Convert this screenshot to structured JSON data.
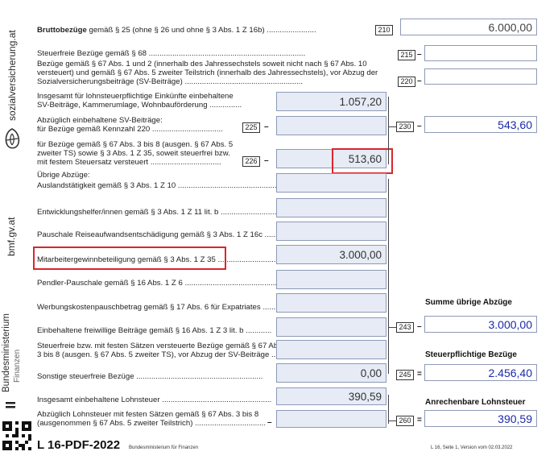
{
  "sidebar": {
    "website_1": "sozialversicherung.at",
    "website_2": "bmf.gv.at",
    "ministry_line1": "Bundesministerium",
    "ministry_line2": "Finanzen"
  },
  "rows": {
    "brutto_bold": "Bruttobezüge",
    "brutto_rest": " gemäß § 25 (ohne § 26 und ohne § 3 Abs. 1 Z 16b) .......................",
    "brutto_code": "210",
    "brutto_value": "6.000,00",
    "steuerfrei_68": "Steuerfreie Bezüge gemäß § 68 .........................................................................",
    "steuerfrei_68_code": "215",
    "bezuege_67_l1": "Bezüge gemäß § 67 Abs. 1 und 2 (innerhalb des Jahressechstels soweit nicht nach § 67 Abs. 10",
    "bezuege_67_l2": "versteuert) und gemäß § 67 Abs. 5 zweiter Teilstrich (innerhalb des Jahressechstels), vor Abzug der",
    "bezuege_67_l3": "Sozialversicherungsbeiträge (SV-Beiträge) .......................................................",
    "bezuege_67_code": "220",
    "insgesamt_l1": "Insgesamt für lohnsteuerpflichtige Einkünfte einbehaltene",
    "insgesamt_l2": "SV-Beiträge, Kammerumlage, Wohnbauförderung ...............",
    "insgesamt_value": "1.057,20",
    "abzueglich_l1": "Abzüglich einbehaltene SV-Beiträge:",
    "abzueglich_l2": "für Bezüge gemäß Kennzahl 220 .................................",
    "abzueglich_code": "225",
    "fuer_l1": "für Bezüge gemäß § 67 Abs. 3 bis 8 (ausgen. § 67 Abs. 5",
    "fuer_l2": "zweiter TS) sowie § 3 Abs. 1 Z 35, soweit steuerfrei bzw.",
    "fuer_l3": "mit festem Steuersatz versteuert .................................",
    "fuer_code": "226",
    "fuer_value": "513,60",
    "sum_230_code": "230",
    "sum_230_value": "543,60",
    "uebrige": "Übrige Abzüge:",
    "ausland": "Auslandstätigkeit gemäß § 3 Abs. 1 Z 10 ..................................................",
    "entwicklung": "Entwicklungshelfer/innen gemäß § 3 Abs. 1 Z 11 lit. b ...............................",
    "pauschale": "Pauschale Reiseaufwandsentschädigung gemäß § 3 Abs. 1 Z 16c ......",
    "mitarbeiter": "Mitarbeitergewinnbeteiligung gemäß § 3 Abs. 1 Z 35 ...............................",
    "mitarbeiter_value": "3.000,00",
    "pendler": "Pendler-Pauschale gemäß § 16 Abs. 1 Z 6 ..................................................",
    "werbung": "Werbungskostenpauschbetrag gemäß § 17 Abs. 6 für Expatriates ...........",
    "freiwillig": "Einbehaltene freiwillige Beiträge gemäß § 16 Abs. 1 Z 3 lit. b ............",
    "steuerfrei_fest_l1": "Steuerfreie bzw. mit festen Sätzen versteuerte Bezüge gemäß § 67 Abs.",
    "steuerfrei_fest_l2": "3 bis 8 (ausgen. § 67 Abs. 5 zweiter TS), vor Abzug der SV-Beiträge ........",
    "sonstige": "Sonstige steuerfreie Bezüge ...........................................................",
    "sonstige_value": "0,00",
    "sum_243_code": "243",
    "sum_243_value": "3.000,00",
    "sum_245_code": "245",
    "sum_245_value": "2.456,40",
    "einbehaltene_lst": "Insgesamt einbehaltene Lohnsteuer ...................................................",
    "einbehaltene_lst_value": "390,59",
    "abzueglich_lst_l1": "Abzüglich Lohnsteuer mit festen Sätzen gemäß § 67 Abs. 3 bis 8",
    "abzueglich_lst_l2": "(ausgenommen § 67 Abs. 5 zweiter Teilstrich) .................................",
    "sum_260_code": "260",
    "sum_260_value": "390,59"
  },
  "right_headers": {
    "summe": "Summe übrige Abzüge",
    "steuerpflichtig": "Steuerpflichtige Bezüge",
    "anrechenbar": "Anrechenbare Lohnsteuer"
  },
  "operators": {
    "minus": "–",
    "equals": "="
  },
  "footer": {
    "title": "L 16-PDF-2022",
    "ministry": "Bundesministerium für Finanzen",
    "page_info": "L 16, Seite 1, Version vom 02.03.2022"
  },
  "colors": {
    "field_fill": "#e6ebf5",
    "field_border": "#8e9ab5",
    "highlight": "#d9262c",
    "value_blue": "#1b2aa8"
  },
  "icons": [
    "sozialversicherung-logo-icon",
    "bmf-eagle-icon",
    "qr-code-icon"
  ]
}
